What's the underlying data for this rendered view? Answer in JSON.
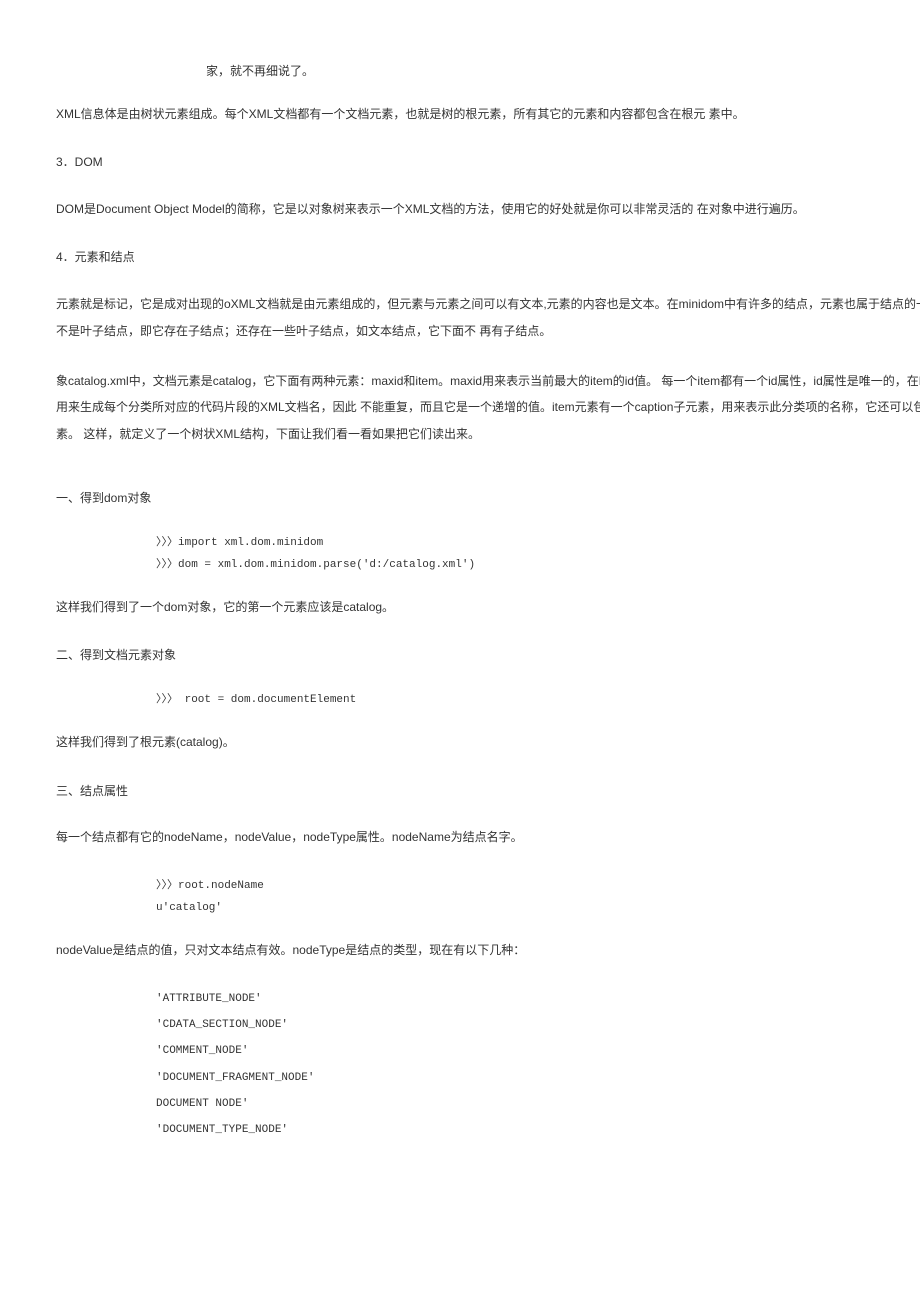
{
  "fragment_top": "家，就不再细说了。",
  "p_xml_body": "XML信息体是由树状元素组成。每个XML文档都有一个文档元素，也就是树的根元素，所有其它的元素和内容都包含在根元 素中。",
  "h_dom": "3．DOM",
  "p_dom": "DOM是Document Object Model的简称，它是以对象树来表示一个XML文档的方法，使用它的好处就是你可以非常灵活的 在对象中进行遍历。",
  "h_elem": "4．元素和结点",
  "p_elem1": "元素就是标记，它是成对出现的oXML文档就是由元素组成的，但元素与元素之间可以有文本,元素的内容也是文本。在minidom中有许多的结点，元素也属于结点的一种，它不是叶子结点，即它存在子结点；还存在一些叶子结点，如文本结点，它下面不 再有子结点。",
  "p_elem2": "象catalog.xml中，文档元素是catalog，它下面有两种元素：maxid和item。maxid用来表示当前最大的item的id值。 每一个item都有一个id属性，id属性是唯一的，在NewEdit中用来生成每个分类所对应的代码片段的XML文档名，因此 不能重复，而且它是一个递增的值。item元素有一个caption子元素，用来表示此分类项的名称，它还可以包含item元素。 这样，就定义了一个树状XML结构，下面让我们看一看如果把它们读出来。",
  "h_s1": "一、得到dom对象",
  "code1": {
    "l1": "〉〉〉import xml.dom.minidom",
    "l2": "〉〉〉dom = xml.dom.minidom.parse('d:/catalog.xml')"
  },
  "p_s1_after": "这样我们得到了一个dom对象，它的第一个元素应该是catalog。",
  "h_s2": "二、得到文档元素对象",
  "code2": {
    "l1": "〉〉〉 root = dom.documentElement"
  },
  "p_s2_after": "这样我们得到了根元素(catalog)。",
  "h_s3": "三、结点属性",
  "p_s3_intro": "每一个结点都有它的nodeName，nodeValue，nodeType属性。nodeName为结点名字。",
  "code3": {
    "l1": "〉〉〉root.nodeName",
    "l2": "u'catalog'"
  },
  "p_s3_after": "nodeValue是结点的值，只对文本结点有效。nodeType是结点的类型，现在有以下几种：",
  "nodetypes": {
    "n1": "'ATTRIBUTE_NODE'",
    "n2": "'CDATA_SECTION_NODE'",
    "n3": "'COMMENT_NODE'",
    "n4": "'DOCUMENT_FRAGMENT_NODE'",
    "n5": " DOCUMENT NODE'",
    "n6": "'DOCUMENT_TYPE_NODE'"
  }
}
